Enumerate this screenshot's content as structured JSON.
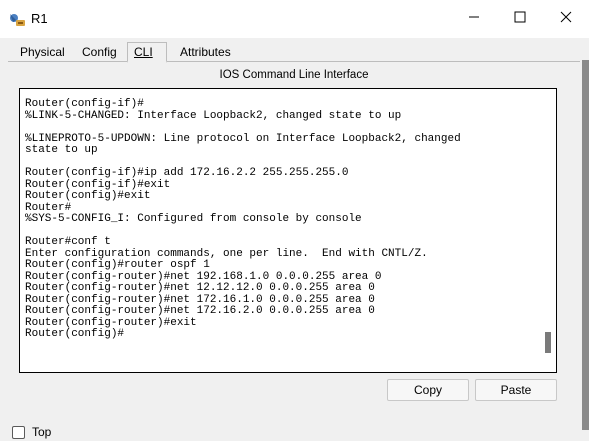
{
  "window": {
    "title": "R1",
    "icon": "router-app-icon",
    "controls": {
      "minimize": "minimize-icon",
      "maximize": "maximize-icon",
      "close": "close-icon"
    }
  },
  "tabs": [
    {
      "label": "Physical",
      "active": false
    },
    {
      "label": "Config",
      "active": false
    },
    {
      "label": "CLI",
      "active": true
    },
    {
      "label": "Attributes",
      "active": false
    }
  ],
  "panel": {
    "heading": "IOS Command Line Interface"
  },
  "terminal": {
    "lines": [
      "Router(config-if)#",
      "%LINK-5-CHANGED: Interface Loopback2, changed state to up",
      "",
      "%LINEPROTO-5-UPDOWN: Line protocol on Interface Loopback2, changed",
      "state to up",
      "",
      "Router(config-if)#ip add 172.16.2.2 255.255.255.0",
      "Router(config-if)#exit",
      "Router(config)#exit",
      "Router#",
      "%SYS-5-CONFIG_I: Configured from console by console",
      "",
      "Router#conf t",
      "Enter configuration commands, one per line.  End with CNTL/Z.",
      "Router(config)#router ospf 1",
      "Router(config-router)#net 192.168.1.0 0.0.0.255 area 0",
      "Router(config-router)#net 12.12.12.0 0.0.0.255 area 0",
      "Router(config-router)#net 172.16.1.0 0.0.0.255 area 0",
      "Router(config-router)#net 172.16.2.0 0.0.0.255 area 0",
      "Router(config-router)#exit",
      "Router(config)#"
    ]
  },
  "buttons": {
    "copy": "Copy",
    "paste": "Paste"
  },
  "footer": {
    "top_label": "Top",
    "top_checked": false
  }
}
